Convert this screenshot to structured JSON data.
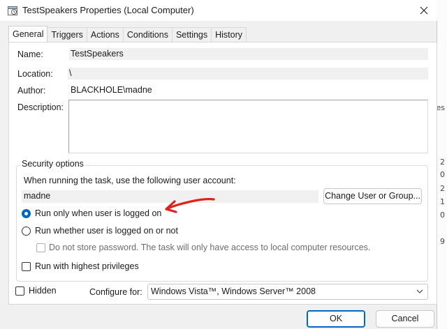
{
  "window": {
    "title": "TestSpeakers Properties (Local Computer)"
  },
  "tabs": [
    "General",
    "Triggers",
    "Actions",
    "Conditions",
    "Settings",
    "History"
  ],
  "general": {
    "name_label": "Name:",
    "name_value": "TestSpeakers",
    "location_label": "Location:",
    "location_value": "\\",
    "author_label": "Author:",
    "author_value": "BLACKHOLE\\madne",
    "description_label": "Description:",
    "description_value": ""
  },
  "security": {
    "group_title": "Security options",
    "account_prompt": "When running the task, use the following user account:",
    "account_value": "madne",
    "change_user_button": "Change User or Group...",
    "radio_logged_on": "Run only when user is logged on",
    "radio_logged_on_or_not": "Run whether user is logged on or not",
    "do_not_store_password": "Do not store password.  The task will only have access to local computer resources.",
    "highest_privileges": "Run with highest privileges",
    "selected_option": "Run only when user is logged on"
  },
  "footer": {
    "hidden_label": "Hidden",
    "configure_label": "Configure for:",
    "configure_value": "Windows Vista™, Windows Server™ 2008",
    "ok_button": "OK",
    "cancel_button": "Cancel"
  },
  "background_glyphs": [
    "2",
    "0",
    "2",
    "1",
    "0",
    "9",
    "es"
  ],
  "colors": {
    "accent": "#0067c0",
    "annotation_arrow": "#e0201a",
    "dialog_bg": "#f0f0f0"
  }
}
